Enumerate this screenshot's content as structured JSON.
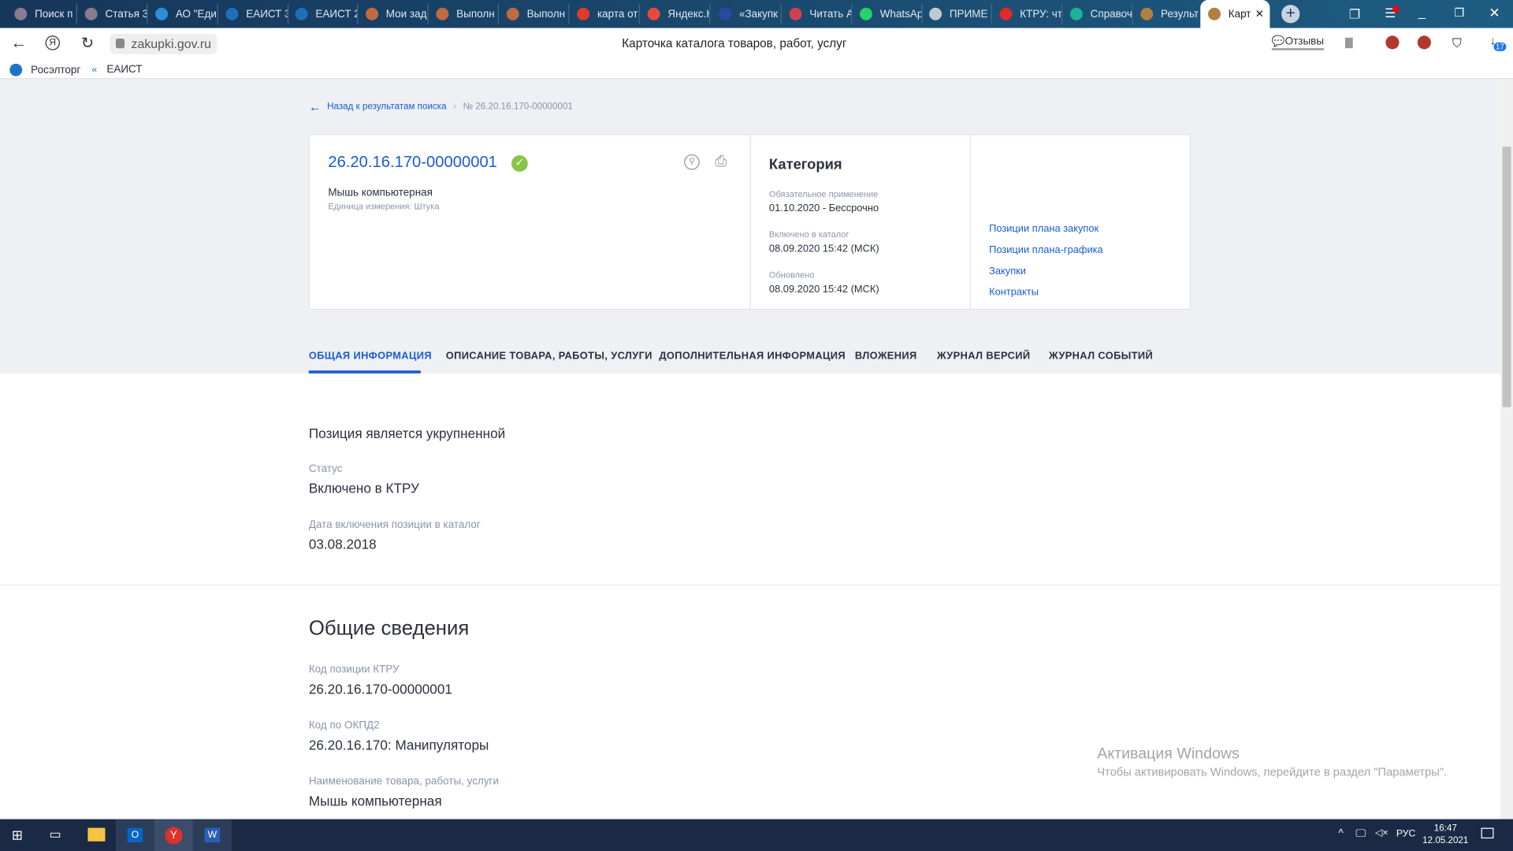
{
  "browser": {
    "tabs": [
      "Поиск п",
      "Статья 3",
      "АО \"Еди",
      "ЕАИСТ 3",
      "ЕАИСТ 2",
      "Мои зад",
      "Выполн",
      "Выполн",
      "карта от",
      "Яндекс.К",
      "«Закупк",
      "Читать А",
      "WhatsAp",
      "ПРИМЕ",
      "КТРУ: чт",
      "Справоч",
      "Результ",
      "Карт"
    ],
    "tab_icon_colors": [
      "#8a7a90",
      "#8a7a90",
      "#2a8fd8",
      "#1d6fb8",
      "#1d6fb8",
      "#c06a40",
      "#c06a40",
      "#c06a40",
      "#e03a2a",
      "#e84a3a",
      "#2a4aa0",
      "#d04050",
      "#25d366",
      "#c0c8d0",
      "#e02a2a",
      "#1ab394",
      "#b08040",
      "#b08040"
    ],
    "address": "zakupki.gov.ru",
    "page_title": "Карточка каталога товаров, работ, услуг",
    "reviews_label": "Отзывы",
    "downloads_badge": "17",
    "bookmarks": [
      "Росэлторг",
      "ЕАИСТ"
    ]
  },
  "breadcrumb": {
    "back": "Назад к результатам поиска",
    "current": "№ 26.20.16.170-00000001"
  },
  "card": {
    "code": "26.20.16.170-00000001",
    "name": "Мышь компьютерная",
    "unit": "Единица измерения: Штука",
    "category_title": "Категория",
    "fields": [
      {
        "label": "Обязательное применение",
        "value": "01.10.2020  - Бессрочно"
      },
      {
        "label": "Включено в каталог",
        "value": "08.09.2020 15:42 (МСК)"
      },
      {
        "label": "Обновлено",
        "value": "08.09.2020 15:42 (МСК)"
      }
    ],
    "links": [
      "Позиции плана закупок",
      "Позиции плана-графика",
      "Закупки",
      "Контракты"
    ]
  },
  "tabs": [
    "ОБЩАЯ ИНФОРМАЦИЯ",
    "ОПИСАНИЕ ТОВАРА, РАБОТЫ, УСЛУГИ",
    "ДОПОЛНИТЕЛЬНАЯ ИНФОРМАЦИЯ",
    "ВЛОЖЕНИЯ",
    "ЖУРНАЛ ВЕРСИЙ",
    "ЖУРНАЛ СОБЫТИЙ"
  ],
  "active_tab": "ОБЩАЯ ИНФОРМАЦИЯ",
  "general": {
    "note": "Позиция является укрупненной",
    "fields": [
      {
        "label": "Статус",
        "value": "Включено в КТРУ"
      },
      {
        "label": "Дата включения позиции в каталог",
        "value": "03.08.2018"
      }
    ]
  },
  "summary": {
    "title": "Общие сведения",
    "fields": [
      {
        "label": "Код позиции КТРУ",
        "value": "26.20.16.170-00000001"
      },
      {
        "label": "Код по ОКПД2",
        "value": "26.20.16.170: Манипуляторы"
      },
      {
        "label": "Наименование товара, работы, услуги",
        "value": "Мышь компьютерная"
      }
    ]
  },
  "watermark": {
    "title": "Активация Windows",
    "text": "Чтобы активировать Windows, перейдите в раздел \"Параметры\"."
  },
  "taskbar": {
    "lang": "РУС",
    "time": "16:47",
    "date": "12.05.2021"
  },
  "colors": {
    "accent": "#1a5bd6",
    "success": "#8bc34a",
    "tabbar": "#1b3d5e",
    "taskbar": "#1b2a44"
  }
}
